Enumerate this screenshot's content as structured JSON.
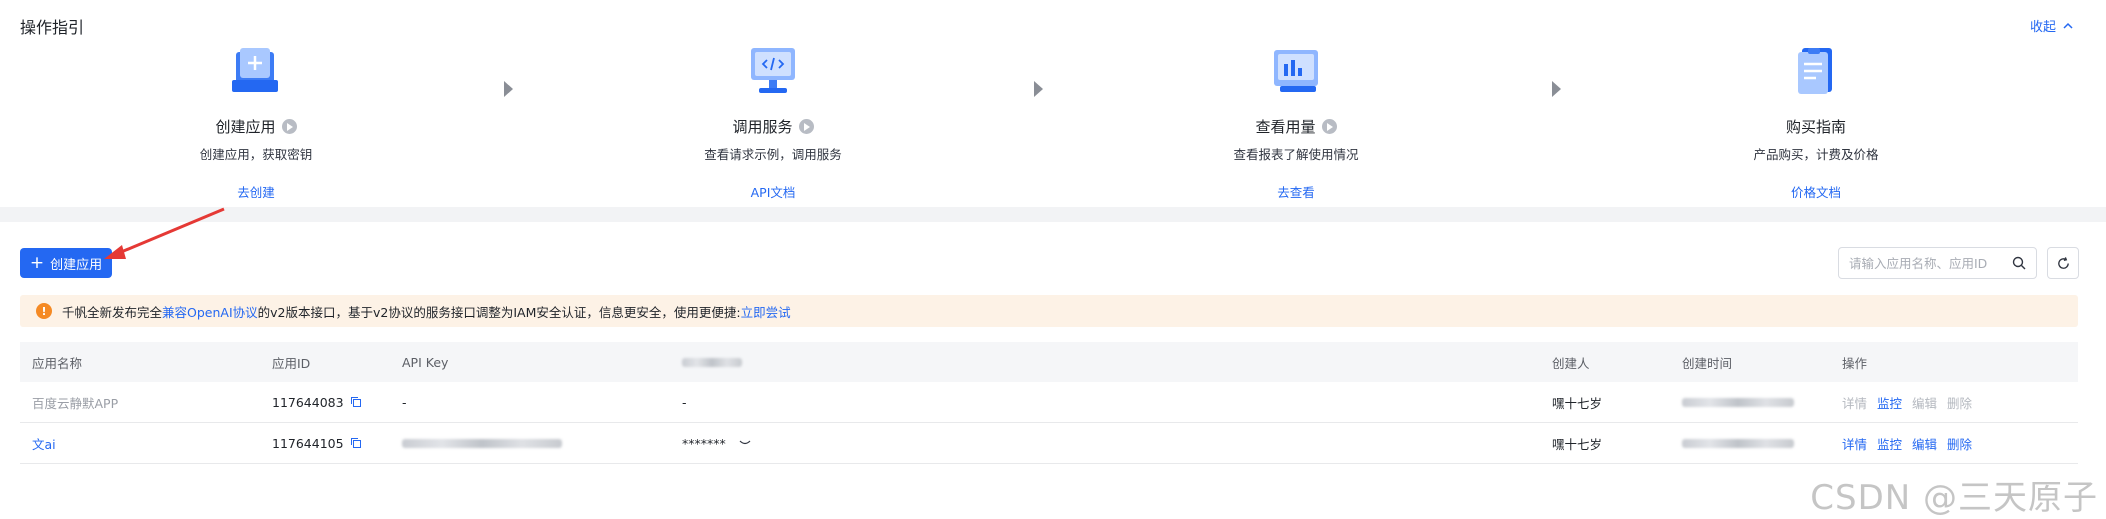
{
  "guide": {
    "title": "操作指引",
    "collapse_label": "收起",
    "steps": [
      {
        "name": "创建应用",
        "desc": "创建应用，获取密钥",
        "link": "去创建",
        "icon": "create-app-icon"
      },
      {
        "name": "调用服务",
        "desc": "查看请求示例，调用服务",
        "link": "API文档",
        "icon": "api-service-icon"
      },
      {
        "name": "查看用量",
        "desc": "查看报表了解使用情况",
        "link": "去查看",
        "icon": "usage-chart-icon"
      },
      {
        "name": "购买指南",
        "desc": "产品购买，计费及价格",
        "link": "价格文档",
        "icon": "purchase-guide-icon"
      }
    ]
  },
  "toolbar": {
    "create_label": "创建应用",
    "search_placeholder": "请输入应用名称、应用ID"
  },
  "notice": {
    "text_before": "千帆全新发布完全",
    "highlight": "兼容OpenAI协议",
    "text_after": "的v2版本接口，基于v2协议的服务接口调整为IAM安全认证，信息更安全，使用更便捷:",
    "try_link": "立即尝试"
  },
  "table": {
    "headers": [
      "应用名称",
      "应用ID",
      "API Key",
      "",
      "创建人",
      "创建时间",
      "操作"
    ],
    "rows": [
      {
        "name": "百度云静默APP",
        "id": "117644083",
        "api_key": "-",
        "secret": "-",
        "creator": "嘿十七岁",
        "actions": [
          "详情",
          "监控",
          "编辑",
          "删除"
        ],
        "name_style": "muted"
      },
      {
        "name": "文ai",
        "id": "117644105",
        "api_key": "",
        "secret": "*******",
        "creator": "嘿十七岁",
        "actions": [
          "详情",
          "监控",
          "编辑",
          "删除"
        ],
        "name_style": "link"
      }
    ]
  },
  "watermark": "CSDN @三天原子",
  "colors": {
    "primary": "#2468f2",
    "warning": "#f58a24",
    "notice_bg": "#fdf2e6",
    "annotation": "#e53935"
  }
}
